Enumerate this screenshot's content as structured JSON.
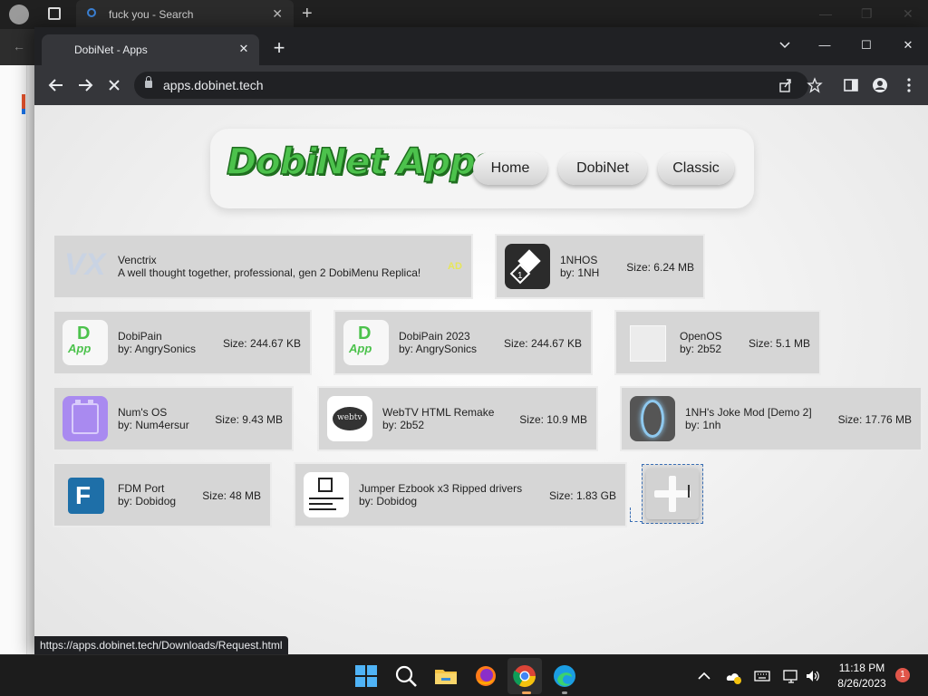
{
  "background_browser": {
    "tab_title": "fuck you - Search"
  },
  "browser": {
    "tab_title": "DobiNet - Apps",
    "url": "apps.dobinet.tech",
    "status_url": "https://apps.dobinet.tech/Downloads/Request.html"
  },
  "header": {
    "logo_text": "DobiNet Apps",
    "nav": [
      {
        "label": "Home"
      },
      {
        "label": "DobiNet"
      },
      {
        "label": "Classic"
      }
    ]
  },
  "apps": [
    {
      "name": "Venctrix",
      "author": "A well thought together, professional, gen 2 DobiMenu Replica!",
      "size": "",
      "badge": "AD",
      "icon": "vx-logo-icon"
    },
    {
      "name": "1NHOS",
      "author": "by: 1NH",
      "size": "Size: 6.24 MB",
      "icon": "1nhos-icon"
    },
    {
      "name": "DobiPain",
      "author": "by: AngrySonics",
      "size": "Size: 244.67 KB",
      "icon": "dobipain-app-icon"
    },
    {
      "name": "DobiPain 2023",
      "author": "by: AngrySonics",
      "size": "Size: 244.67 KB",
      "icon": "dobipain-app-icon"
    },
    {
      "name": "OpenOS",
      "author": "by: 2b52",
      "size": "Size: 5.1 MB",
      "icon": "openos-icon"
    },
    {
      "name": "Num's OS",
      "author": "by: Num4ersur",
      "size": "Size: 9.43 MB",
      "icon": "nums-os-icon"
    },
    {
      "name": "WebTV HTML Remake",
      "author": "by: 2b52",
      "size": "Size: 10.9 MB",
      "icon": "webtv-icon"
    },
    {
      "name": "1NH's Joke Mod [Demo 2]",
      "author": "by: 1nh",
      "size": "Size: 17.76 MB",
      "icon": "portal-icon"
    },
    {
      "name": "FDM Port",
      "author": "by: Dobidog",
      "size": "Size: 48 MB",
      "icon": "fdm-icon"
    },
    {
      "name": "Jumper Ezbook x3 Ripped drivers",
      "author": "by: Dobidog",
      "size": "Size: 1.83 GB",
      "icon": "jumper-drivers-icon"
    }
  ],
  "taskbar": {
    "time": "11:18 PM",
    "date": "8/26/2023",
    "notification_count": "1"
  },
  "colors": {
    "logo_green": "#4cc24c",
    "logo_outline": "#1f6e1f",
    "card_bg": "#d6d6d6",
    "chrome_dark": "#202124",
    "toolbar": "#35363a"
  }
}
